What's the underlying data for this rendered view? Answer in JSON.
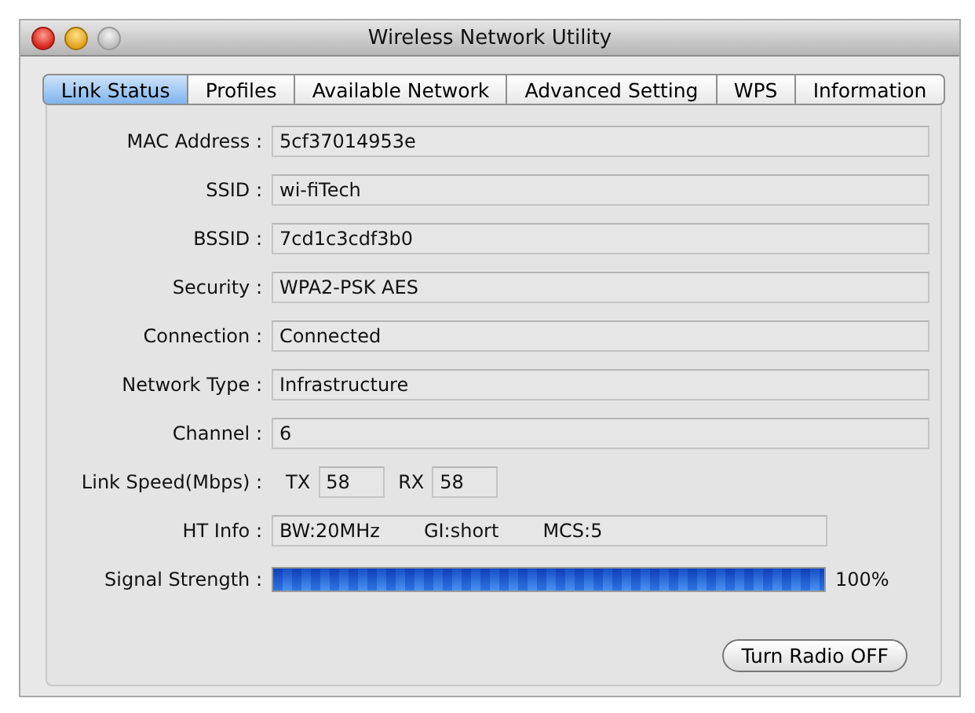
{
  "window": {
    "title": "Wireless Network Utility"
  },
  "tabs": [
    {
      "label": "Link Status",
      "selected": true
    },
    {
      "label": "Profiles",
      "selected": false
    },
    {
      "label": "Available Network",
      "selected": false
    },
    {
      "label": "Advanced Setting",
      "selected": false
    },
    {
      "label": "WPS",
      "selected": false
    },
    {
      "label": "Information",
      "selected": false
    }
  ],
  "fields": [
    {
      "kind": "text",
      "label": "MAC Address :",
      "value": "5cf37014953e"
    },
    {
      "kind": "text",
      "label": "SSID :",
      "value": "wi-fiTech"
    },
    {
      "kind": "text",
      "label": "BSSID :",
      "value": "7cd1c3cdf3b0"
    },
    {
      "kind": "text",
      "label": "Security :",
      "value": "WPA2-PSK AES"
    },
    {
      "kind": "text",
      "label": "Connection :",
      "value": "Connected"
    },
    {
      "kind": "text",
      "label": "Network Type :",
      "value": "Infrastructure"
    },
    {
      "kind": "text",
      "label": "Channel :",
      "value": "6"
    },
    {
      "kind": "speed",
      "label": "Link Speed(Mbps) :",
      "tx_label": "TX",
      "tx": "58",
      "rx_label": "RX",
      "rx": "58"
    },
    {
      "kind": "ht",
      "label": "HT Info :",
      "parts": [
        "BW:20MHz",
        "GI:short",
        "MCS:5"
      ]
    },
    {
      "kind": "signal",
      "label": "Signal Strength :",
      "level": 1.0,
      "reading": "100%"
    }
  ],
  "button": "Turn Radio OFF"
}
